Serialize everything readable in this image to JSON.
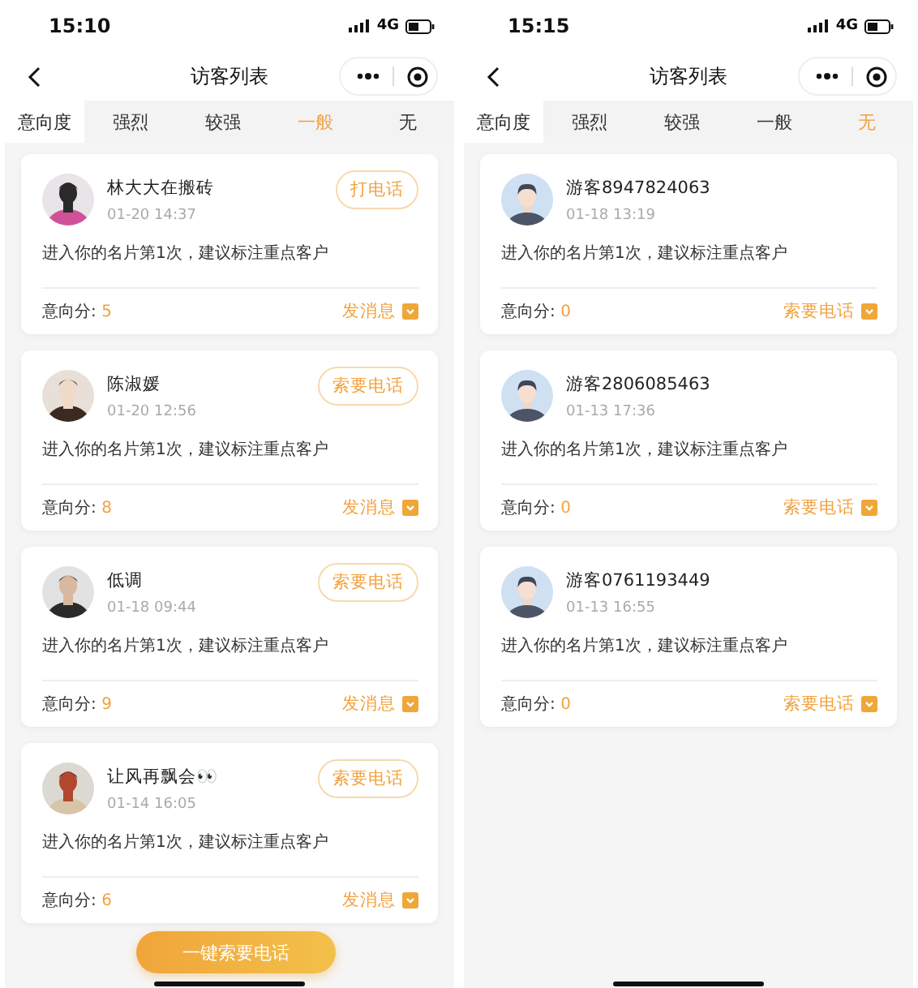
{
  "screens": [
    {
      "status_bar": {
        "time": "15:10",
        "network": "4G"
      },
      "nav": {
        "title": "访客列表"
      },
      "filter": {
        "label": "意向度",
        "tabs": [
          {
            "label": "强烈",
            "selected": false
          },
          {
            "label": "较强",
            "selected": false
          },
          {
            "label": "一般",
            "selected": true
          },
          {
            "label": "无",
            "selected": false
          }
        ]
      },
      "visitors": [
        {
          "name": "林大大在搬砖",
          "time": "01-20 14:37",
          "call_button": "打电话",
          "message": "进入你的名片第1次，建议标注重点客户",
          "score_label": "意向分:",
          "score": "5",
          "action": "发消息"
        },
        {
          "name": "陈淑媛",
          "time": "01-20 12:56",
          "call_button": "索要电话",
          "message": "进入你的名片第1次，建议标注重点客户",
          "score_label": "意向分:",
          "score": "8",
          "action": "发消息"
        },
        {
          "name": "低调",
          "time": "01-18 09:44",
          "call_button": "索要电话",
          "message": "进入你的名片第1次，建议标注重点客户",
          "score_label": "意向分:",
          "score": "9",
          "action": "发消息"
        },
        {
          "name": "让风再飘会👀",
          "time": "01-14 16:05",
          "call_button": "索要电话",
          "message": "进入你的名片第1次，建议标注重点客户",
          "score_label": "意向分:",
          "score": "6",
          "action": "发消息"
        }
      ],
      "floating_button": "一键索要电话"
    },
    {
      "status_bar": {
        "time": "15:15",
        "network": "4G"
      },
      "nav": {
        "title": "访客列表"
      },
      "filter": {
        "label": "意向度",
        "tabs": [
          {
            "label": "强烈",
            "selected": false
          },
          {
            "label": "较强",
            "selected": false
          },
          {
            "label": "一般",
            "selected": false
          },
          {
            "label": "无",
            "selected": true
          }
        ]
      },
      "visitors": [
        {
          "avatar": {
            "kind": "default"
          },
          "name": "游客8947824063",
          "time": "01-18 13:19",
          "message": "进入你的名片第1次，建议标注重点客户",
          "score_label": "意向分:",
          "score": "0",
          "action": "索要电话"
        },
        {
          "avatar": {
            "kind": "default"
          },
          "name": "游客2806085463",
          "time": "01-13 17:36",
          "message": "进入你的名片第1次，建议标注重点客户",
          "score_label": "意向分:",
          "score": "0",
          "action": "索要电话"
        },
        {
          "avatar": {
            "kind": "default"
          },
          "name": "游客0761193449",
          "time": "01-13 16:55",
          "message": "进入你的名片第1次，建议标注重点客户",
          "score_label": "意向分:",
          "score": "0",
          "action": "索要电话"
        }
      ]
    }
  ]
}
